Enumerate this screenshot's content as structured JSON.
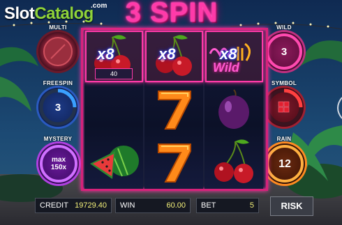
{
  "logo": {
    "brand_a": "Slot",
    "brand_b": "Catalog",
    "suffix": ".com"
  },
  "game_title": "3 SPIN",
  "left_panel": [
    {
      "label": "MULTI",
      "value": ""
    },
    {
      "label": "FREESPIN",
      "value": "3"
    },
    {
      "label": "MYSTERY",
      "value_line1": "max",
      "value_line2": "150x"
    }
  ],
  "right_panel": [
    {
      "label": "WILD",
      "value": "3"
    },
    {
      "label": "SYMBOL",
      "value": ""
    },
    {
      "label": "RAIN",
      "value": "12"
    }
  ],
  "reels": {
    "top_row": [
      {
        "symbol": "cherry-icon",
        "multiplier": "x8",
        "badge": "40"
      },
      {
        "symbol": "cherry-icon",
        "multiplier": "x8"
      },
      {
        "symbol": "wild-icon",
        "multiplier": "x8",
        "wild_text": "Wild"
      }
    ],
    "middle_row": [
      "empty",
      "seven-icon",
      "plum-icon"
    ],
    "bottom_row": [
      "watermelon-icon",
      "seven-icon",
      "cherry-icon"
    ]
  },
  "footer": {
    "credit_label": "CREDIT",
    "credit_value": "19729.40",
    "win_label": "WIN",
    "win_value": "60.00",
    "bet_label": "BET",
    "bet_value": "5",
    "risk_label": "RISK"
  },
  "colors": {
    "accent": "#ff3aa9",
    "brand_green": "#8fd33a",
    "value_yellow": "#f5f27a"
  }
}
